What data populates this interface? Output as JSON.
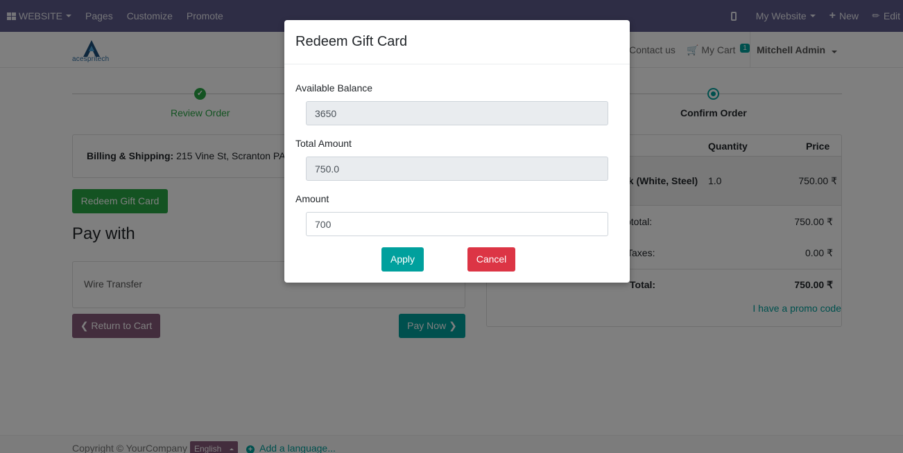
{
  "topbar": {
    "website_label": "WEBSITE",
    "pages_label": "Pages",
    "customize_label": "Customize",
    "promote_label": "Promote",
    "my_website_label": "My Website",
    "new_label": "New",
    "edit_label": "Edit"
  },
  "header": {
    "logo_text": "acespritech",
    "contact_label": "Contact us",
    "cart_label": "My Cart",
    "cart_count": "1",
    "user_name": "Mitchell Admin"
  },
  "steps": {
    "review_label": "Review Order",
    "confirm_label": "Confirm Order"
  },
  "billing": {
    "label": "Billing & Shipping:",
    "address": "215 Vine St, Scranton PA"
  },
  "redeem_button_label": "Redeem Gift Card",
  "pay_with_title": "Pay with",
  "payment_method": "Wire Transfer",
  "return_button_label": "Return to Cart",
  "pay_now_button_label": "Pay Now",
  "summary": {
    "quantity_header": "Quantity",
    "price_header": "Price",
    "product_name": "sk (White, Steel)",
    "product_qty": "1.0",
    "product_price": "750.00 ₹",
    "subtotal_label": "btotal:",
    "subtotal_value": "750.00 ₹",
    "taxes_label": "Taxes:",
    "taxes_value": "0.00 ₹",
    "total_label": "Total:",
    "total_value": "750.00 ₹",
    "promo_link": "I have a promo code"
  },
  "footer": {
    "copyright": "Copyright © YourCompany",
    "language": "English",
    "add_language": "Add a language..."
  },
  "modal": {
    "title": "Redeem Gift Card",
    "available_balance_label": "Available Balance",
    "available_balance_value": "3650",
    "total_amount_label": "Total Amount",
    "total_amount_value": "750.0",
    "amount_label": "Amount",
    "amount_value": "700",
    "apply_label": "Apply",
    "cancel_label": "Cancel"
  },
  "colors": {
    "topbar": "#5c5a8a",
    "primary": "#00a09d",
    "success": "#28a745",
    "danger": "#dc3545",
    "secondary": "#875a7b"
  }
}
